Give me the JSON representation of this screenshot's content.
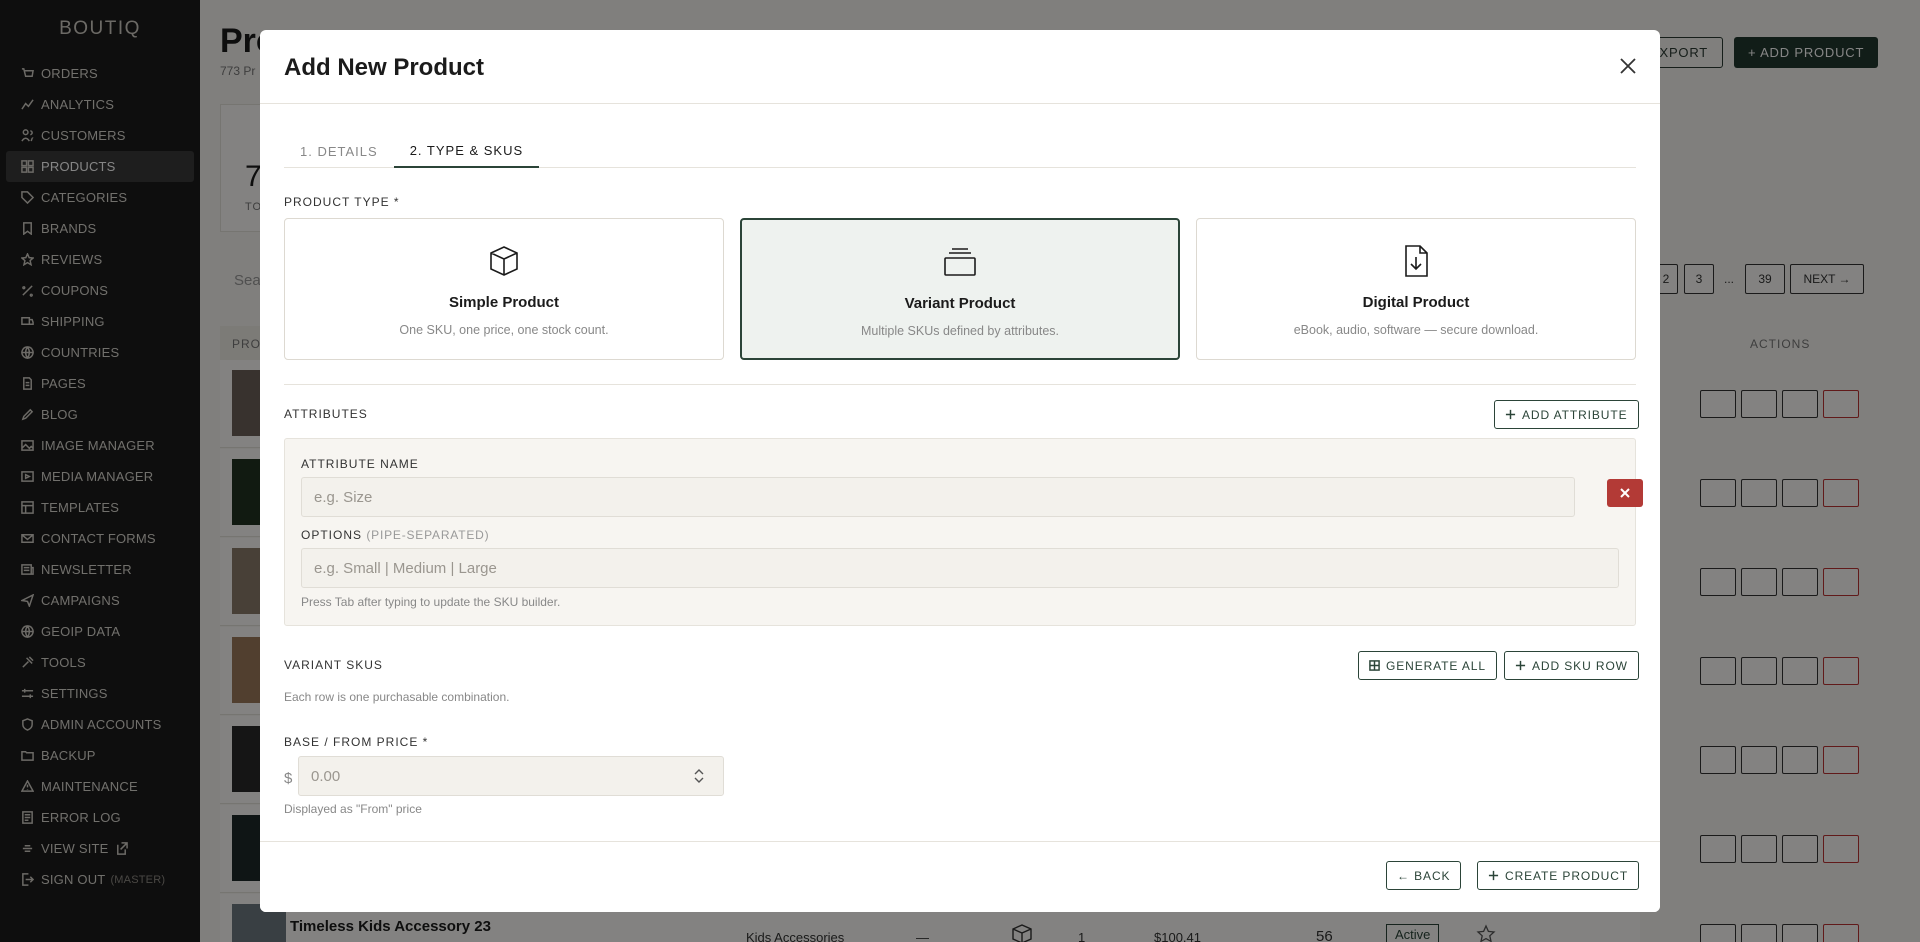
{
  "sidebar": {
    "brand": "BOUTIQ",
    "items": [
      {
        "label": "ORDERS",
        "icon": "cart-icon"
      },
      {
        "label": "ANALYTICS",
        "icon": "chart-icon"
      },
      {
        "label": "CUSTOMERS",
        "icon": "users-icon"
      },
      {
        "label": "PRODUCTS",
        "icon": "grid-icon",
        "active": true
      },
      {
        "label": "CATEGORIES",
        "icon": "tag-icon"
      },
      {
        "label": "BRANDS",
        "icon": "bookmark-icon"
      },
      {
        "label": "REVIEWS",
        "icon": "star-icon"
      },
      {
        "label": "COUPONS",
        "icon": "percent-icon"
      },
      {
        "label": "SHIPPING",
        "icon": "truck-icon"
      },
      {
        "label": "COUNTRIES",
        "icon": "globe-icon"
      },
      {
        "label": "PAGES",
        "icon": "page-icon"
      },
      {
        "label": "BLOG",
        "icon": "pen-icon"
      },
      {
        "label": "IMAGE MANAGER",
        "icon": "image-icon"
      },
      {
        "label": "MEDIA MANAGER",
        "icon": "media-icon"
      },
      {
        "label": "TEMPLATES",
        "icon": "template-icon"
      },
      {
        "label": "CONTACT FORMS",
        "icon": "mail-icon"
      },
      {
        "label": "NEWSLETTER",
        "icon": "newsletter-icon"
      },
      {
        "label": "CAMPAIGNS",
        "icon": "send-icon"
      },
      {
        "label": "GEOIP DATA",
        "icon": "globe-icon"
      },
      {
        "label": "TOOLS",
        "icon": "tools-icon"
      },
      {
        "label": "SETTINGS",
        "icon": "sliders-icon"
      },
      {
        "label": "ADMIN ACCOUNTS",
        "icon": "shield-icon"
      },
      {
        "label": "BACKUP",
        "icon": "folder-icon"
      },
      {
        "label": "MAINTENANCE",
        "icon": "warning-icon"
      },
      {
        "label": "ERROR LOG",
        "icon": "log-icon"
      },
      {
        "label": "VIEW SITE",
        "icon": "external-icon"
      },
      {
        "label": "SIGN OUT",
        "icon": "signout-icon",
        "sub": "(MASTER)"
      }
    ]
  },
  "background": {
    "title": "Pro",
    "subtitle": "773 Pr",
    "export_label": "EXPORT",
    "add_label": "+ ADD PRODUCT",
    "stat_number": "7",
    "stat_label": "TO",
    "search_placeholder": "Sea",
    "pager": [
      "2",
      "3",
      "...",
      "39",
      "NEXT →"
    ],
    "col_product": "PRO",
    "col_actions": "ACTIONS",
    "last_row": {
      "name": "Timeless Kids Accessory 23",
      "category": "Kids Accessories",
      "dash": "—",
      "qty": "1",
      "price": "$100.41",
      "stock": "56",
      "status": "Active"
    }
  },
  "modal": {
    "title": "Add New Product",
    "tabs": [
      "1. DETAILS",
      "2. TYPE & SKUS"
    ],
    "product_type_label": "PRODUCT TYPE *",
    "types": [
      {
        "title": "Simple Product",
        "desc": "One SKU, one price, one stock count.",
        "icon": "box-icon"
      },
      {
        "title": "Variant Product",
        "desc": "Multiple SKUs defined by attributes.",
        "icon": "layers-icon",
        "selected": true
      },
      {
        "title": "Digital Product",
        "desc": "eBook, audio, software — secure download.",
        "icon": "download-file-icon"
      }
    ],
    "attributes_label": "ATTRIBUTES",
    "add_attribute_label": "ADD ATTRIBUTE",
    "attr_name_label": "ATTRIBUTE NAME",
    "attr_name_placeholder": "e.g. Size",
    "options_label": "OPTIONS",
    "options_sub": "(PIPE-SEPARATED)",
    "options_placeholder": "e.g. Small | Medium | Large",
    "attr_hint": "Press Tab after typing to update the SKU builder.",
    "variant_skus_label": "VARIANT SKUS",
    "variant_skus_hint": "Each row is one purchasable combination.",
    "generate_all_label": "GENERATE ALL",
    "add_sku_row_label": "ADD SKU ROW",
    "base_price_label": "BASE / FROM PRICE *",
    "currency_symbol": "$",
    "price_placeholder": "0.00",
    "price_hint": "Displayed as \"From\" price",
    "back_label": "← BACK",
    "create_label": "CREATE PRODUCT"
  }
}
